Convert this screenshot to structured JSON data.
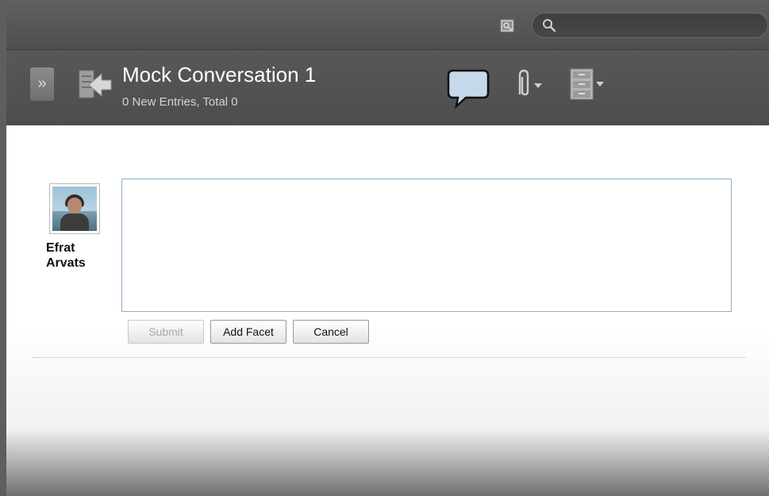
{
  "search": {
    "placeholder": "",
    "value": ""
  },
  "conversation": {
    "title": "Mock Conversation 1",
    "subtitle": "0 New Entries, Total 0"
  },
  "icons": {
    "expand": "double-chevron-right-icon",
    "back": "back-arrow-icon",
    "media": "media-icon",
    "search": "search-icon",
    "chat": "speech-bubble-icon",
    "attach": "paperclip-icon",
    "cabinet": "file-cabinet-icon"
  },
  "user": {
    "first_name": "Efrat",
    "last_name": "Arvats"
  },
  "editor": {
    "value": ""
  },
  "buttons": {
    "submit": "Submit",
    "add_facet": "Add Facet",
    "cancel": "Cancel"
  },
  "colors": {
    "header": "#555555",
    "editor_border": "#8fb0c8",
    "chat_icon": "#bcd3e6"
  }
}
